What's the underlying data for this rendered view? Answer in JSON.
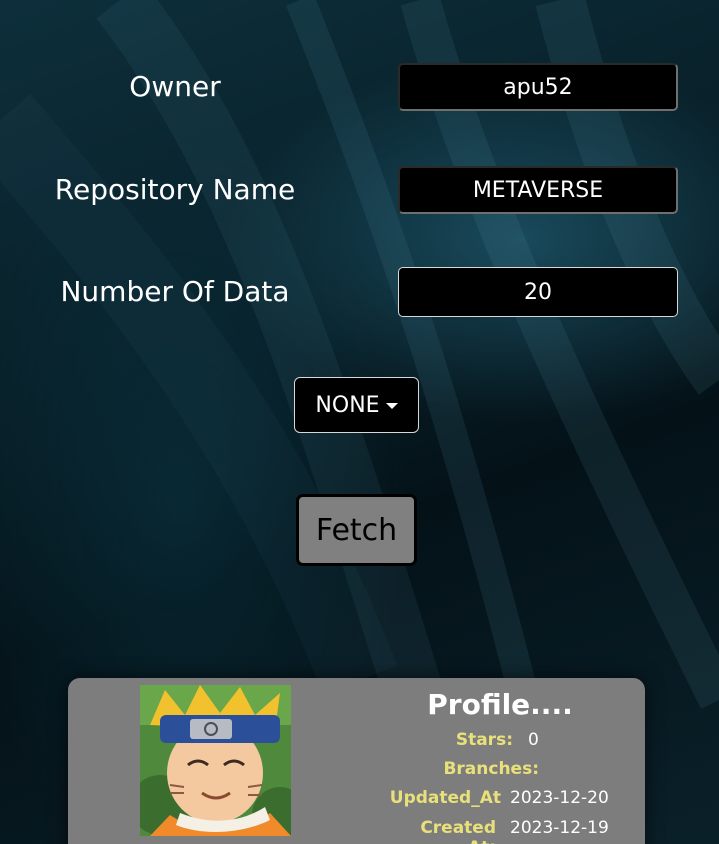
{
  "form": {
    "owner_label": "Owner",
    "owner_value": "apu52",
    "repo_label": "Repository Name",
    "repo_value": "METAVERSE",
    "count_label": "Number Of Data",
    "count_value": "20",
    "dropdown_label": "NONE",
    "fetch_label": "Fetch"
  },
  "profile": {
    "title": "Profile....",
    "stars_label": "Stars:",
    "stars_value": "0",
    "branches_label": "Branches:",
    "branches_value": "",
    "updated_label": "Updated_At",
    "updated_value": "2023-12-20",
    "created_label": "Created At:",
    "created_value": "2023-12-19"
  },
  "colors": {
    "field_bg": "#000000",
    "button_bg": "#808080",
    "card_bg": "#7d7d7d",
    "stat_label": "#e9e07a"
  }
}
